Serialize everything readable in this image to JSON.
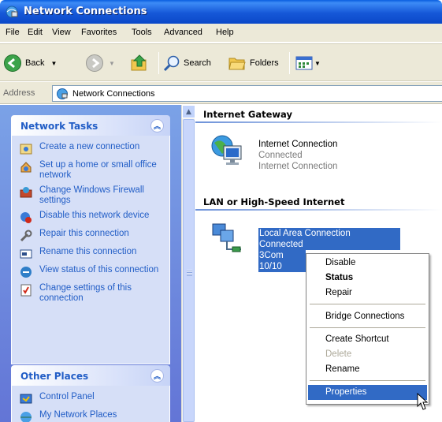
{
  "window": {
    "title": "Network Connections"
  },
  "menu": [
    "File",
    "Edit",
    "View",
    "Favorites",
    "Tools",
    "Advanced",
    "Help"
  ],
  "toolbar": {
    "back_label": "Back",
    "search_label": "Search",
    "folders_label": "Folders"
  },
  "address": {
    "label": "Address",
    "value": "Network Connections"
  },
  "network_tasks": {
    "title": "Network Tasks",
    "items": [
      {
        "label": "Create a new connection",
        "icon": "new-connection-icon"
      },
      {
        "label": "Set up a home or small office network",
        "icon": "home-network-icon"
      },
      {
        "label": "Change Windows Firewall settings",
        "icon": "firewall-icon"
      },
      {
        "label": "Disable this network device",
        "icon": "disable-device-icon"
      },
      {
        "label": "Repair this connection",
        "icon": "repair-icon"
      },
      {
        "label": "Rename this connection",
        "icon": "rename-icon"
      },
      {
        "label": "View status of this connection",
        "icon": "status-icon"
      },
      {
        "label": "Change settings of this connection",
        "icon": "settings-icon"
      }
    ]
  },
  "other_places": {
    "title": "Other Places",
    "items": [
      {
        "label": "Control Panel",
        "icon": "control-panel-icon"
      },
      {
        "label": "My Network Places",
        "icon": "network-places-icon"
      }
    ]
  },
  "content": {
    "gateway_group": "Internet Gateway",
    "gateway_item": {
      "name": "Internet Connection",
      "status": "Connected",
      "type": "Internet Connection"
    },
    "lan_group": "LAN or High-Speed Internet",
    "lan_item": {
      "name": "Local Area Connection",
      "status": "Connected",
      "device": "3Com 10/10"
    }
  },
  "context_menu": {
    "disable": "Disable",
    "status": "Status",
    "repair": "Repair",
    "bridge": "Bridge Connections",
    "shortcut": "Create Shortcut",
    "delete": "Delete",
    "rename": "Rename",
    "properties": "Properties"
  },
  "colors": {
    "accent": "#316ac5",
    "task_link": "#215dc6",
    "pane_top": "#7ba2e7",
    "pane_bottom": "#6375d6"
  }
}
